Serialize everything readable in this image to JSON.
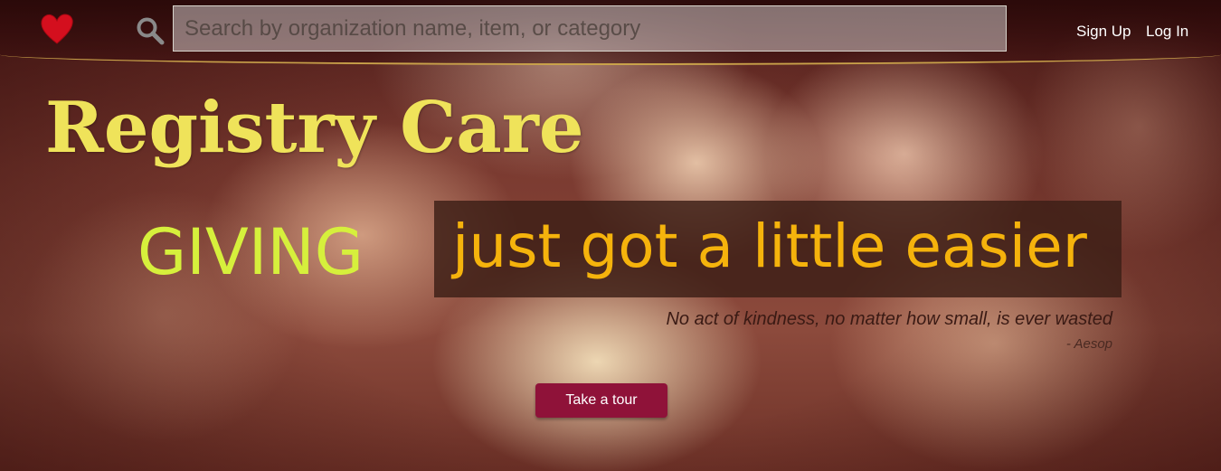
{
  "header": {
    "logo_icon": "heart-icon",
    "search_icon": "search-icon",
    "search_placeholder": "Search by organization name, item, or category",
    "search_value": "",
    "signup_label": "Sign Up",
    "login_label": "Log In"
  },
  "hero": {
    "title": "Registry Care",
    "giving": "GIVING",
    "tagline": "just got a little easier",
    "quote": "No act of kindness, no matter how small, is ever wasted",
    "quote_author": "- Aesop",
    "tour_label": "Take a tour"
  },
  "colors": {
    "logo_heart": "#d40f1e",
    "title": "#efe35a",
    "giving": "#d6f03c",
    "tagline": "#f5b30c",
    "tour_button": "#8f1239",
    "nav_border": "#c9a24a"
  }
}
